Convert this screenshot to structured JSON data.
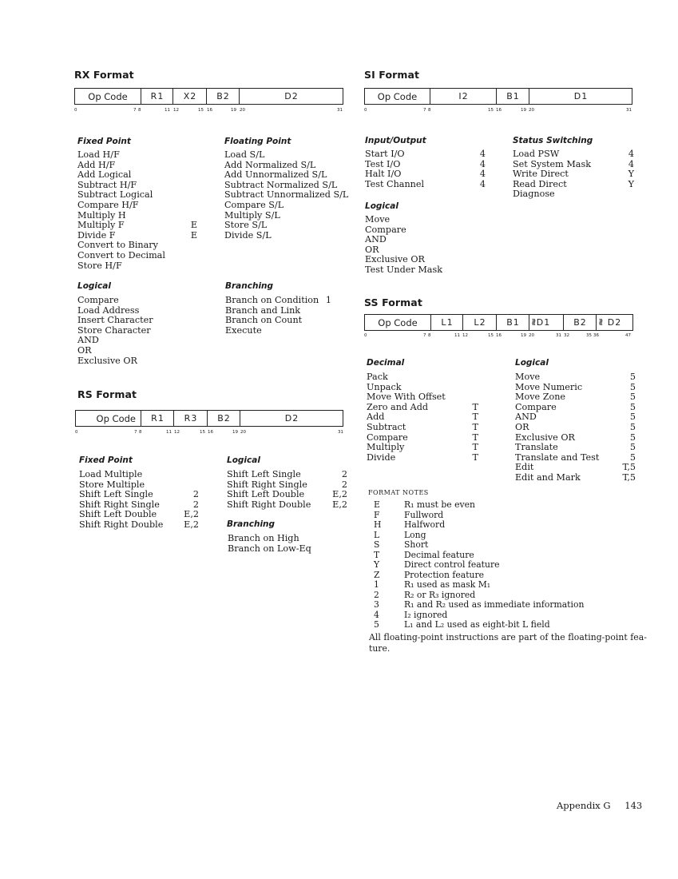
{
  "rx": {
    "title": "RX Format",
    "fields": [
      {
        "label": "Op Code",
        "sub": ""
      },
      {
        "label": "R",
        "sub": "1"
      },
      {
        "label": "X",
        "sub": "2"
      },
      {
        "label": "B",
        "sub": "2"
      },
      {
        "label": "D",
        "sub": "2"
      }
    ],
    "bits": [
      "0",
      "7",
      "8",
      "11",
      "12",
      "15",
      "16",
      "19",
      "20",
      "31"
    ],
    "fixed_point": {
      "heading": "Fixed Point",
      "items": [
        {
          "name": "Load H/F",
          "note": ""
        },
        {
          "name": "Add H/F",
          "note": ""
        },
        {
          "name": "Add Logical",
          "note": ""
        },
        {
          "name": "Subtract H/F",
          "note": ""
        },
        {
          "name": "Subtract Logical",
          "note": ""
        },
        {
          "name": "Compare H/F",
          "note": ""
        },
        {
          "name": "Multiply H",
          "note": ""
        },
        {
          "name": "Multiply F",
          "note": "E"
        },
        {
          "name": "Divide F",
          "note": "E"
        },
        {
          "name": "Convert to Binary",
          "note": ""
        },
        {
          "name": "Convert to Decimal",
          "note": ""
        },
        {
          "name": "Store H/F",
          "note": ""
        }
      ]
    },
    "floating_point": {
      "heading": "Floating Point",
      "items": [
        {
          "name": "Load S/L",
          "note": ""
        },
        {
          "name": "Add Normalized S/L",
          "note": ""
        },
        {
          "name": "Add Unnormalized S/L",
          "note": ""
        },
        {
          "name": "Subtract Normalized S/L",
          "note": ""
        },
        {
          "name": "Subtract Unnormalized S/L",
          "note": ""
        },
        {
          "name": "Compare S/L",
          "note": ""
        },
        {
          "name": "Multiply S/L",
          "note": ""
        },
        {
          "name": "Store S/L",
          "note": ""
        },
        {
          "name": "Divide S/L",
          "note": ""
        }
      ]
    },
    "logical": {
      "heading": "Logical",
      "items": [
        {
          "name": "Compare",
          "note": ""
        },
        {
          "name": "Load Address",
          "note": ""
        },
        {
          "name": "Insert Character",
          "note": ""
        },
        {
          "name": "Store Character",
          "note": ""
        },
        {
          "name": "AND",
          "note": ""
        },
        {
          "name": "OR",
          "note": ""
        },
        {
          "name": "Exclusive OR",
          "note": ""
        }
      ]
    },
    "branching": {
      "heading": "Branching",
      "items": [
        {
          "name": "Branch on Condition",
          "note": "1"
        },
        {
          "name": "Branch and Link",
          "note": ""
        },
        {
          "name": "Branch on Count",
          "note": ""
        },
        {
          "name": "Execute",
          "note": ""
        }
      ]
    }
  },
  "rs": {
    "title": "RS Format",
    "fields": [
      {
        "label": "Op Code",
        "sub": ""
      },
      {
        "label": "R",
        "sub": "1"
      },
      {
        "label": "R",
        "sub": "3"
      },
      {
        "label": "B",
        "sub": "2"
      },
      {
        "label": "D",
        "sub": "2"
      }
    ],
    "bits": [
      "0",
      "7",
      "8",
      "11",
      "12",
      "15",
      "16",
      "19",
      "20",
      "31"
    ],
    "fixed_point": {
      "heading": "Fixed Point",
      "items": [
        {
          "name": "Load Multiple",
          "note": ""
        },
        {
          "name": "Store Multiple",
          "note": ""
        },
        {
          "name": "Shift Left Single",
          "note": "2"
        },
        {
          "name": "Shift Right Single",
          "note": "2"
        },
        {
          "name": "Shift Left Double",
          "note": "E,2"
        },
        {
          "name": "Shift Right Double",
          "note": "E,2"
        }
      ]
    },
    "logical": {
      "heading": "Logical",
      "items": [
        {
          "name": "Shift Left Single",
          "note": "2"
        },
        {
          "name": "Shift Right Single",
          "note": "2"
        },
        {
          "name": "Shift Left Double",
          "note": "E,2"
        },
        {
          "name": "Shift Right Double",
          "note": "E,2"
        }
      ]
    },
    "branching": {
      "heading": "Branching",
      "items": [
        {
          "name": "Branch on High",
          "note": ""
        },
        {
          "name": "Branch on Low-Eq",
          "note": ""
        }
      ]
    }
  },
  "si": {
    "title": "SI Format",
    "fields": [
      {
        "label": "Op Code",
        "sub": ""
      },
      {
        "label": "I",
        "sub": "2"
      },
      {
        "label": "B",
        "sub": "1"
      },
      {
        "label": "D",
        "sub": "1"
      }
    ],
    "bits": [
      "0",
      "7",
      "8",
      "15",
      "16",
      "19",
      "20",
      "31"
    ],
    "io": {
      "heading": "Input/Output",
      "items": [
        {
          "name": "Start I/O",
          "note": "4"
        },
        {
          "name": "Test I/O",
          "note": "4"
        },
        {
          "name": "Halt I/O",
          "note": "4"
        },
        {
          "name": "Test Channel",
          "note": "4"
        }
      ]
    },
    "status": {
      "heading": "Status Switching",
      "items": [
        {
          "name": "Load PSW",
          "note": "4"
        },
        {
          "name": "Set System Mask",
          "note": "4"
        },
        {
          "name": "Write Direct",
          "note": "Y"
        },
        {
          "name": "Read Direct",
          "note": "Y"
        },
        {
          "name": "Diagnose",
          "note": ""
        }
      ]
    },
    "logical": {
      "heading": "Logical",
      "items": [
        {
          "name": "Move",
          "note": ""
        },
        {
          "name": "Compare",
          "note": ""
        },
        {
          "name": "AND",
          "note": ""
        },
        {
          "name": "OR",
          "note": ""
        },
        {
          "name": "Exclusive OR",
          "note": ""
        },
        {
          "name": "Test Under Mask",
          "note": ""
        }
      ]
    }
  },
  "ss": {
    "title": "SS Format",
    "fields": [
      {
        "label": "Op Code",
        "sub": ""
      },
      {
        "label": "L",
        "sub": "1"
      },
      {
        "label": "L",
        "sub": "2"
      },
      {
        "label": "B",
        "sub": "1"
      },
      {
        "label": "D",
        "sub": "1"
      },
      {
        "label": "B",
        "sub": "2"
      },
      {
        "label": "D",
        "sub": "2"
      }
    ],
    "bits": [
      "0",
      "7",
      "8",
      "11",
      "12",
      "15",
      "16",
      "19",
      "20",
      "31",
      "32",
      "35",
      "36",
      "47"
    ],
    "decimal": {
      "heading": "Decimal",
      "items": [
        {
          "name": "Pack",
          "note": ""
        },
        {
          "name": "Unpack",
          "note": ""
        },
        {
          "name": "Move With Offset",
          "note": ""
        },
        {
          "name": "Zero and Add",
          "note": "T"
        },
        {
          "name": "Add",
          "note": "T"
        },
        {
          "name": "Subtract",
          "note": "T"
        },
        {
          "name": "Compare",
          "note": "T"
        },
        {
          "name": "Multiply",
          "note": "T"
        },
        {
          "name": "Divide",
          "note": "T"
        }
      ]
    },
    "logical": {
      "heading": "Logical",
      "items": [
        {
          "name": "Move",
          "note": "5"
        },
        {
          "name": "Move Numeric",
          "note": "5"
        },
        {
          "name": "Move Zone",
          "note": "5"
        },
        {
          "name": "Compare",
          "note": "5"
        },
        {
          "name": "AND",
          "note": "5"
        },
        {
          "name": "OR",
          "note": "5"
        },
        {
          "name": "Exclusive OR",
          "note": "5"
        },
        {
          "name": "Translate",
          "note": "5"
        },
        {
          "name": "Translate and Test",
          "note": "5"
        },
        {
          "name": "Edit",
          "note": "T,5"
        },
        {
          "name": "Edit and Mark",
          "note": "T,5"
        }
      ]
    }
  },
  "format_notes": {
    "title": "FORMAT NOTES",
    "items": [
      {
        "key": "E",
        "text": "R₁ must be even"
      },
      {
        "key": "F",
        "text": "Fullword"
      },
      {
        "key": "H",
        "text": "Halfword"
      },
      {
        "key": "L",
        "text": "Long"
      },
      {
        "key": "S",
        "text": "Short"
      },
      {
        "key": "T",
        "text": "Decimal feature"
      },
      {
        "key": "Y",
        "text": "Direct control feature"
      },
      {
        "key": "Z",
        "text": "Protection feature"
      },
      {
        "key": "1",
        "text": "R₁ used as mask M₁"
      },
      {
        "key": "2",
        "text": "R₂ or R₃ ignored"
      },
      {
        "key": "3",
        "text": "R₁ and R₂ used as immediate information"
      },
      {
        "key": "4",
        "text": "I₂ ignored"
      },
      {
        "key": "5",
        "text": "L₁ and L₂ used as eight-bit L field"
      }
    ],
    "footnote_line1": "All floating-point instructions are part of the floating-point fea-",
    "footnote_line2": "ture."
  },
  "footer": {
    "section": "Appendix G",
    "page_number": "143"
  }
}
